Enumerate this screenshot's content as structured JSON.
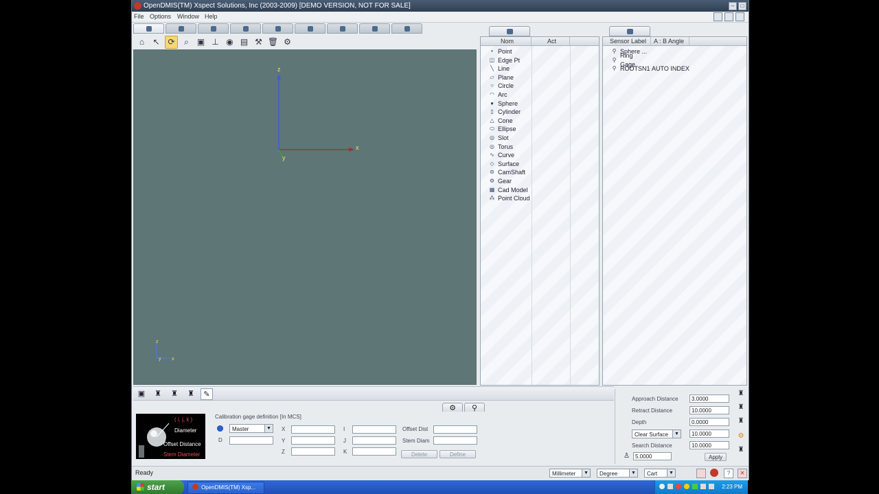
{
  "window": {
    "title": "OpenDMIS(TM) Xspect Solutions, Inc (2003-2009) [DEMO VERSION, NOT FOR SALE]"
  },
  "menu": {
    "items": [
      "File",
      "Options",
      "Window",
      "Help"
    ]
  },
  "viewport": {
    "axes": {
      "x": "x",
      "y": "y",
      "z": "z"
    },
    "mini_axes": {
      "x": "x",
      "y": "y",
      "z": "z"
    }
  },
  "feature_panel": {
    "columns": [
      "Nom",
      "Act"
    ],
    "features": [
      {
        "label": "Point",
        "icon": "point-icon"
      },
      {
        "label": "Edge Pt",
        "icon": "edge-point-icon"
      },
      {
        "label": "Line",
        "icon": "line-icon"
      },
      {
        "label": "Plane",
        "icon": "plane-icon"
      },
      {
        "label": "Circle",
        "icon": "circle-icon"
      },
      {
        "label": "Arc",
        "icon": "arc-icon"
      },
      {
        "label": "Sphere",
        "icon": "sphere-icon"
      },
      {
        "label": "Cylinder",
        "icon": "cylinder-icon"
      },
      {
        "label": "Cone",
        "icon": "cone-icon"
      },
      {
        "label": "Ellipse",
        "icon": "ellipse-icon"
      },
      {
        "label": "Slot",
        "icon": "slot-icon"
      },
      {
        "label": "Torus",
        "icon": "torus-icon"
      },
      {
        "label": "Curve",
        "icon": "curve-icon"
      },
      {
        "label": "Surface",
        "icon": "surface-icon"
      },
      {
        "label": "CamShaft",
        "icon": "camshaft-icon"
      },
      {
        "label": "Gear",
        "icon": "gear-icon"
      },
      {
        "label": "Cad Model",
        "icon": "cad-model-icon"
      },
      {
        "label": "Point Cloud",
        "icon": "point-cloud-icon"
      }
    ]
  },
  "sensor_panel": {
    "columns": [
      "Sensor Label",
      "A : B Angle"
    ],
    "items": [
      {
        "label": "Sphere ...",
        "angle": ""
      },
      {
        "label": "Ring Gage",
        "angle": ""
      },
      {
        "label": "ROOTSN1",
        "angle": "AUTO INDEX"
      }
    ]
  },
  "calibration": {
    "heading": "Calibration gage definition [In MCS]",
    "image_labels": {
      "ijk": "( i, j, k )",
      "diameter": "Diameter",
      "offset": "Offset Distance",
      "stem": "Stem Diameter"
    },
    "master_value": "Master",
    "labels": {
      "d": "D",
      "x": "X",
      "y": "Y",
      "z": "Z",
      "i": "I",
      "j": "J",
      "k": "K",
      "offset_dist": "Offset Dist",
      "stem_diam": "Stem Diam"
    },
    "buttons": {
      "delete": "Delete",
      "define": "Define"
    }
  },
  "probe_settings": {
    "approach_label": "Approach Distance",
    "approach_value": "3.0000",
    "retract_label": "Retract Distance",
    "retract_value": "10.0000",
    "depth_label": "Depth",
    "depth_value": "0.0000",
    "clear_mode": "Clear Surface",
    "clear_value": "10.0000",
    "search_label": "Search Distance",
    "search_value": "10.0000",
    "speed_value": "5.0000",
    "apply_label": "Apply"
  },
  "status": {
    "text": "Ready",
    "units": "Millimeter",
    "angle": "Degree",
    "coord": "Cart"
  },
  "taskbar": {
    "start": "start",
    "app_item": "OpenDMIS(TM) Xsp...",
    "clock": "2:23 PM"
  }
}
